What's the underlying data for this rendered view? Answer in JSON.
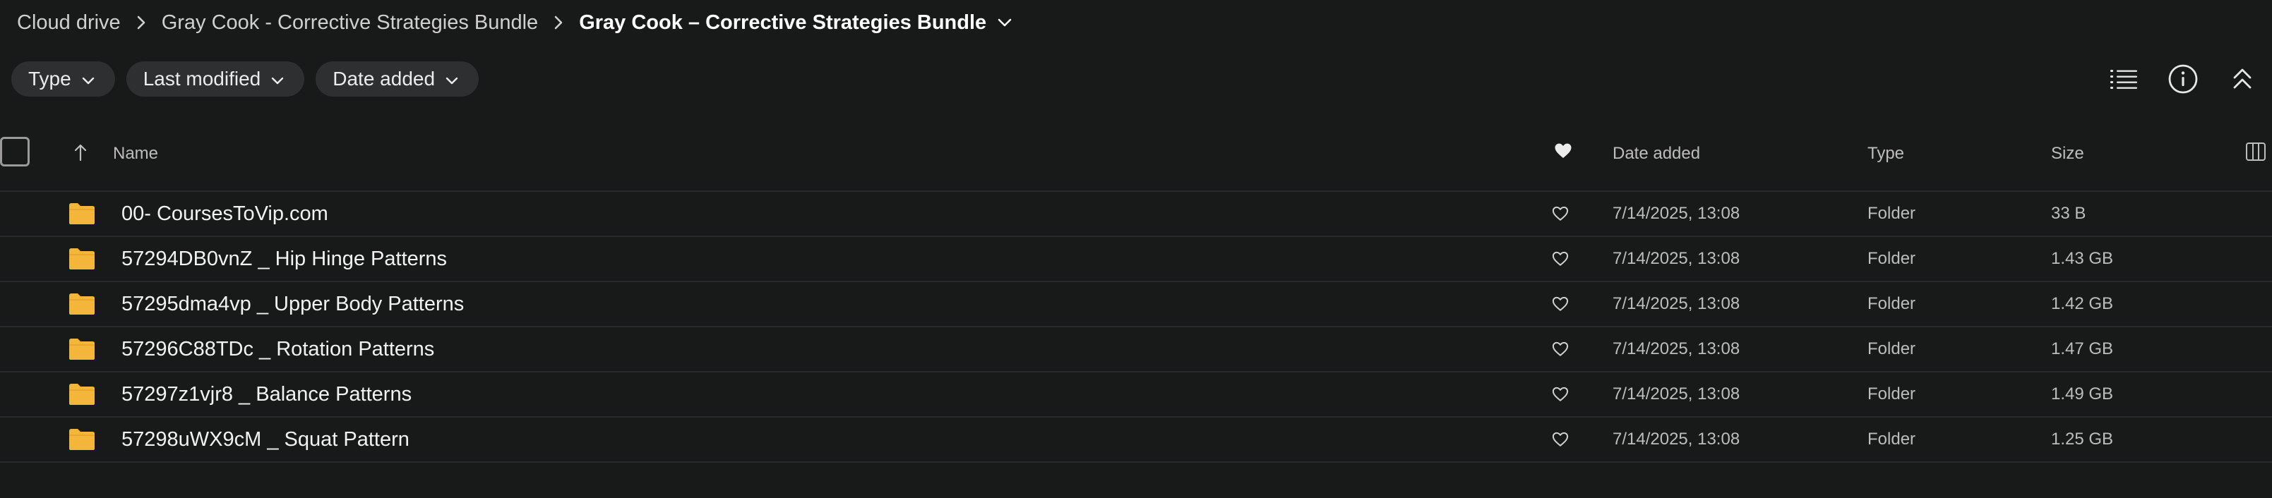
{
  "breadcrumb": {
    "root": "Cloud drive",
    "parent": "Gray Cook - Corrective Strategies Bundle",
    "current": "Gray Cook – Corrective Strategies Bundle"
  },
  "filters": {
    "type": "Type",
    "last_modified": "Last modified",
    "date_added": "Date added"
  },
  "table": {
    "columns": {
      "name": "Name",
      "date_added": "Date added",
      "type": "Type",
      "size": "Size"
    },
    "rows": [
      {
        "name": "00- CoursesToVip.com",
        "date_added": "7/14/2025, 13:08",
        "type": "Folder",
        "size": "33 B"
      },
      {
        "name": "57294DB0vnZ _ Hip Hinge Patterns",
        "date_added": "7/14/2025, 13:08",
        "type": "Folder",
        "size": "1.43 GB"
      },
      {
        "name": "57295dma4vp _ Upper Body Patterns",
        "date_added": "7/14/2025, 13:08",
        "type": "Folder",
        "size": "1.42 GB"
      },
      {
        "name": "57296C88TDc _ Rotation Patterns",
        "date_added": "7/14/2025, 13:08",
        "type": "Folder",
        "size": "1.47 GB"
      },
      {
        "name": "57297z1vjr8 _ Balance Patterns",
        "date_added": "7/14/2025, 13:08",
        "type": "Folder",
        "size": "1.49 GB"
      },
      {
        "name": "57298uWX9cM _ Squat Pattern",
        "date_added": "7/14/2025, 13:08",
        "type": "Folder",
        "size": "1.25 GB"
      }
    ]
  },
  "icons": {
    "folder": "folder-icon",
    "favorite": "heart-outline-icon",
    "favorite_column": "heart-filled-icon",
    "list_view": "list-view-icon",
    "info": "info-icon",
    "collapse": "collapse-up-icon",
    "columns": "columns-icon",
    "sort": "sort-ascending-icon"
  },
  "colors": {
    "background": "#181919",
    "chip_background": "#2d2f30",
    "folder": "#f3b63a",
    "row_divider": "#2a2b2c"
  }
}
